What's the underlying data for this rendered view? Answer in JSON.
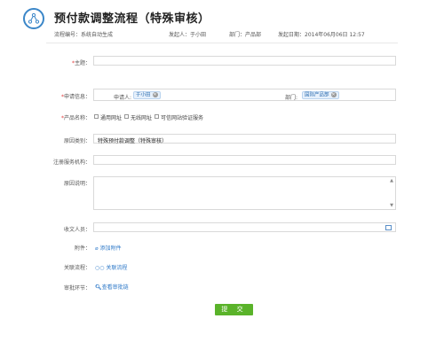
{
  "header": {
    "title": "预付款调整流程（特殊审核）",
    "flow_no": "流程编号：系统自动生成",
    "initiator": "发起人：于小田",
    "department": "部门：产品部",
    "date": "发起日期：2014年06月06日 12:57"
  },
  "form": {
    "subject": {
      "label": "主题：",
      "required_mark": "*",
      "value": ""
    },
    "applicant_info": {
      "label": "申请信息：",
      "required_mark": "*",
      "applicant_label": "申请人:",
      "applicant_value": "于小田",
      "dept_label": "部门:",
      "dept_value": "国际产品部"
    },
    "product": {
      "label": "产品名称：",
      "required_mark": "*",
      "options": [
        "通用网址",
        "无线网址",
        "可信网站验证服务"
      ]
    },
    "reason_type": {
      "label": "原因类别：",
      "value": "特殊预付款调整（特殊审核）"
    },
    "registrar": {
      "label": "注册服务机构：",
      "value": ""
    },
    "reason_desc": {
      "label": "原因说明：",
      "value": ""
    },
    "recipients": {
      "label": "收文人员：",
      "value": ""
    },
    "attachment": {
      "label": "附件：",
      "link": "添加附件"
    },
    "related_flow": {
      "label": "关联流程：",
      "link": "关联流程"
    },
    "approval": {
      "label": "审批环节：",
      "link": "查看审批链"
    },
    "submit_label": "提 交"
  },
  "colors": {
    "accent": "#3a86c8",
    "submit": "#5ab32a",
    "required": "#e03c3c",
    "tag_bg": "#e6f0fb"
  }
}
